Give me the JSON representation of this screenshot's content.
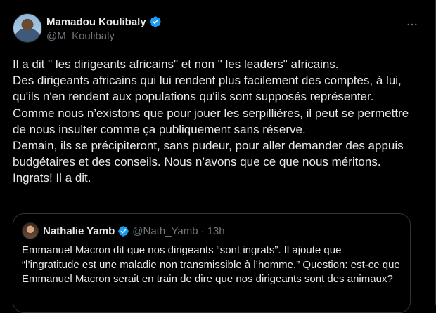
{
  "tweet": {
    "author": {
      "display_name": "Mamadou Koulibaly",
      "handle": "@M_Koulibaly",
      "verified": true
    },
    "more_icon": "more-horizontal-icon",
    "text": "Il a dit \" les dirigeants africains\" et non \" les leaders\" africains.\nDes dirigeants africains qui lui rendent plus facilement des comptes, à lui, qu'ils n'en rendent aux populations qu'ils sont supposés représenter.\nComme nous n’existons que pour jouer les serpillières, il peut se permettre de nous insulter comme ça publiquement sans réserve.\nDemain, ils se précipiteront, sans pudeur, pour aller demander des appuis budgétaires et des conseils. Nous n’avons que ce que nous méritons.\nIngrats! Il a dit."
  },
  "quoted_tweet": {
    "author": {
      "display_name": "Nathalie Yamb",
      "handle": "@Nath_Yamb",
      "verified": true
    },
    "separator": "·",
    "time": "13h",
    "text": "Emmanuel Macron dit que nos dirigeants “sont ingrats”. Il ajoute que “l’ingratitude est une maladie non transmissible à l’homme.” Question: est-ce que Emmanuel Macron serait en train de dire que nos dirigeants sont des animaux?"
  },
  "colors": {
    "background": "#000000",
    "text": "#e7e9ea",
    "secondary": "#71767b",
    "verified": "#1d9bf0",
    "border": "#2f3336"
  }
}
